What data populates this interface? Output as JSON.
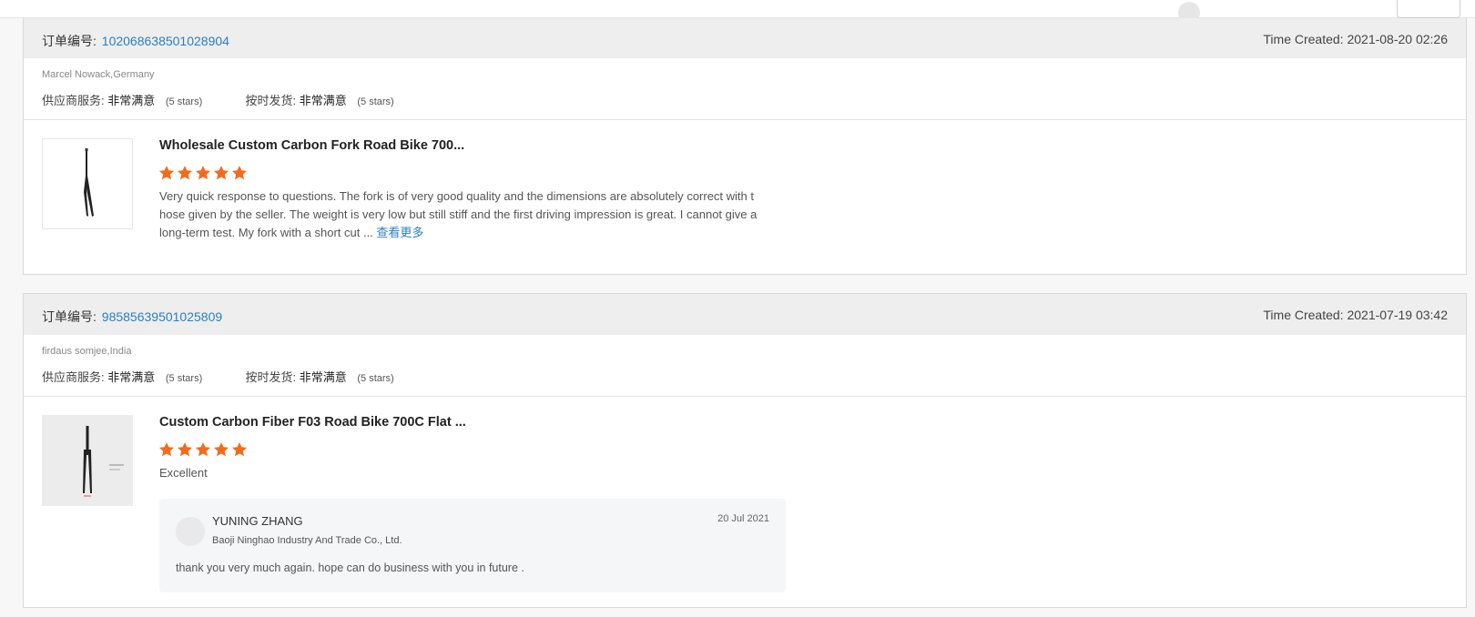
{
  "colors": {
    "accent_link": "#2a7fc1",
    "star": "#f26b1d",
    "header_bg": "#eeeeee"
  },
  "orders": [
    {
      "order_label": "订单编号:",
      "order_number": "102068638501028904",
      "time_created": "Time Created: 2021-08-20 02:26",
      "buyer": "Marcel Nowack,Germany",
      "supplier_service_label": "供应商服务:",
      "supplier_service_value": "非常满意",
      "supplier_service_stars": "(5 stars)",
      "on_time_label": "按时发货:",
      "on_time_value": "非常满意",
      "on_time_stars": "(5 stars)",
      "product_title": "Wholesale Custom Carbon Fork Road Bike 700...",
      "rating": 5,
      "review_text": "Very quick response to questions. The fork is of very good quality and the dimensions are absolutely correct with those given by the seller. The weight is very low but still stiff and the first driving impression is great. I cannot give a long-term test. My fork with a short cut ...",
      "view_more": "查看更多"
    },
    {
      "order_label": "订单编号:",
      "order_number": "98585639501025809",
      "time_created": "Time Created: 2021-07-19 03:42",
      "buyer": "firdaus somjee,India",
      "supplier_service_label": "供应商服务:",
      "supplier_service_value": "非常满意",
      "supplier_service_stars": "(5 stars)",
      "on_time_label": "按时发货:",
      "on_time_value": "非常满意",
      "on_time_stars": "(5 stars)",
      "product_title": "Custom Carbon Fiber F03 Road Bike 700C Flat ...",
      "rating": 5,
      "review_text": "Excellent",
      "reply": {
        "name": "YUNING ZHANG",
        "company": "Baoji Ninghao Industry And Trade Co., Ltd.",
        "date": "20 Jul 2021",
        "text": "thank you very much again. hope can do business with you in future ."
      }
    }
  ]
}
